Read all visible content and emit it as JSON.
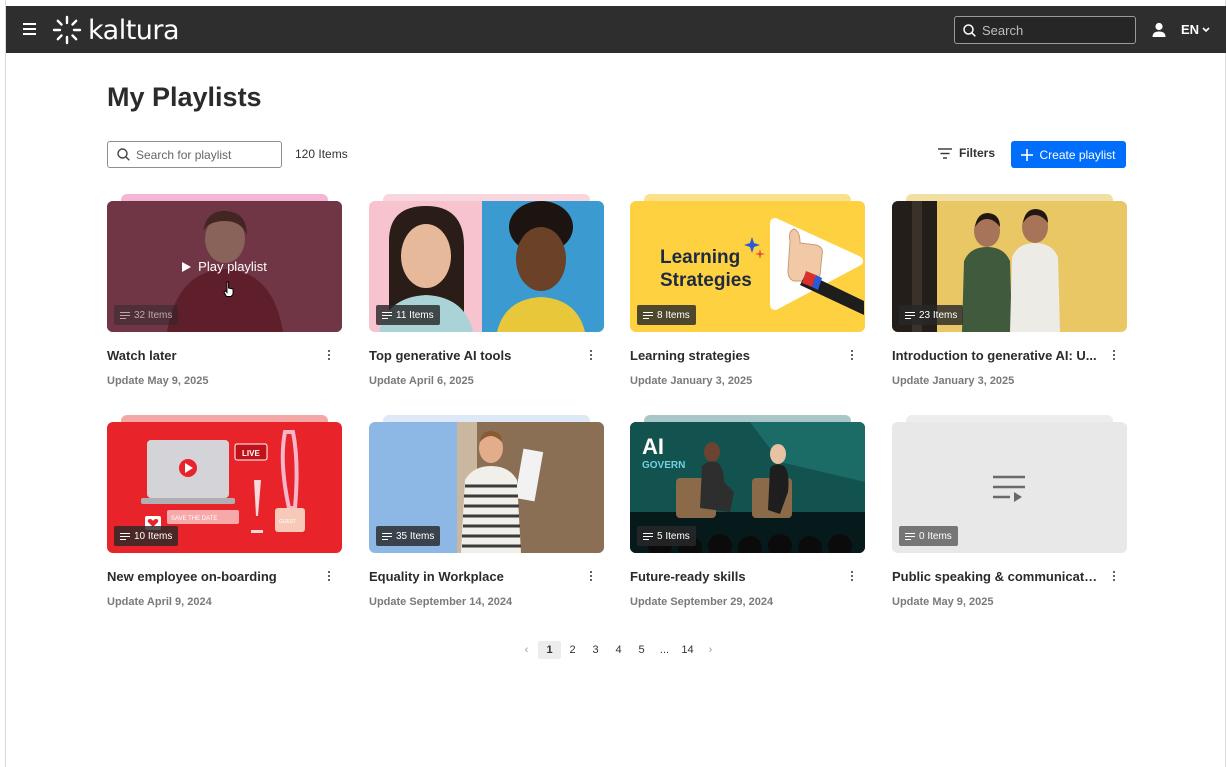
{
  "header": {
    "logo_text": "kaltura",
    "search_placeholder": "Search",
    "language": "EN"
  },
  "page": {
    "title": "My Playlists",
    "search_placeholder": "Search for playlist",
    "items_count": "120 Items",
    "filters_label": "Filters",
    "create_label": "Create playlist"
  },
  "hover_card": {
    "play_label": "Play playlist"
  },
  "cards": [
    {
      "title": "Watch later",
      "updated": "Update May 9, 2025",
      "items": "32 Items",
      "stack_color": "#f3b7d5"
    },
    {
      "title": "Top generative AI tools",
      "updated": "Update April 6, 2025",
      "items": "11 Items",
      "stack_color": "#f9d6de"
    },
    {
      "title": "Learning strategies",
      "updated": "Update January 3, 2025",
      "items": "8 Items",
      "stack_color": "#fbe18c"
    },
    {
      "title": "Introduction to generative AI: U...",
      "updated": "Update January 3, 2025",
      "items": "23 Items",
      "stack_color": "#f2dfa4"
    },
    {
      "title": "New employee on-boarding",
      "updated": "Update April 9, 2024",
      "items": "10 Items",
      "stack_color": "#f4a8a6"
    },
    {
      "title": "Equality in Workplace",
      "updated": "Update September 14, 2024",
      "items": "35 Items",
      "stack_color": "#dde9f6"
    },
    {
      "title": "Future-ready skills",
      "updated": "Update September 29, 2024",
      "items": "5 Items",
      "stack_color": "#a9c7c8"
    },
    {
      "title": "Public speaking & communicatio...",
      "updated": "Update May 9, 2025",
      "items": "0 Items",
      "stack_color": "#ededed"
    }
  ],
  "thumb_text": {
    "learning_line1": "Learning",
    "learning_line2": "Strategies",
    "live": "LIVE",
    "save_the_date": "SAVE THE DATE",
    "guest": "GUEST",
    "ai": "AI",
    "govern": "GOVERN"
  },
  "pagination": {
    "pages": [
      "1",
      "2",
      "3",
      "4",
      "5",
      "...",
      "14"
    ],
    "current": "1"
  },
  "colors": {
    "header_bg": "#2e2e2e",
    "primary": "#006efa"
  }
}
